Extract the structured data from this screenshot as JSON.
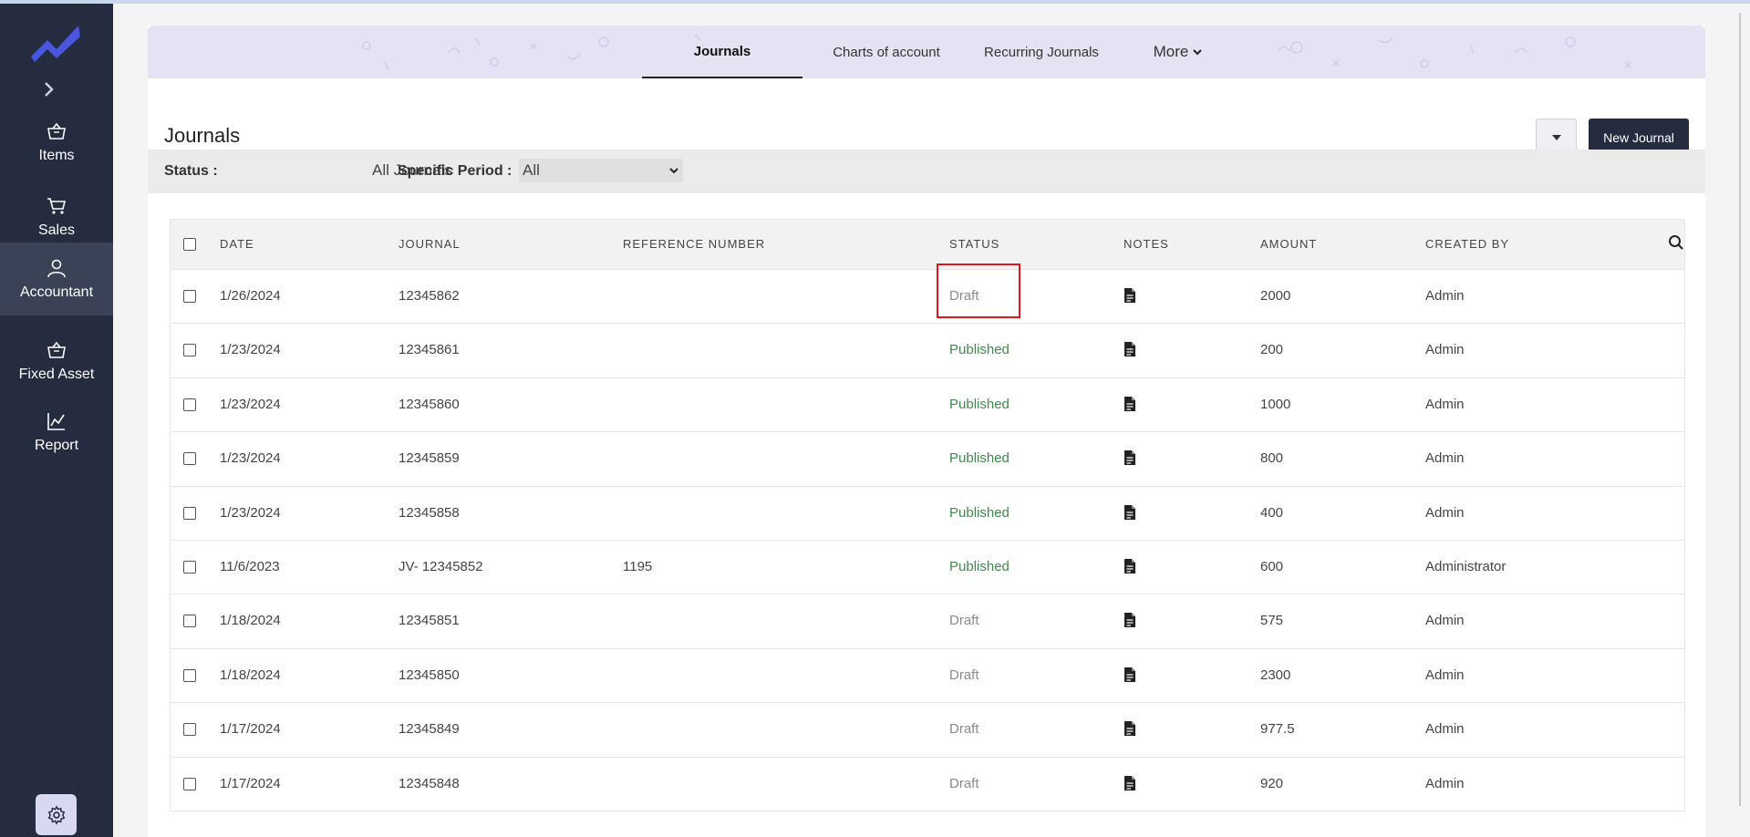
{
  "sidebar": {
    "items": [
      {
        "label": "Items",
        "icon": "basket-icon"
      },
      {
        "label": "Sales",
        "icon": "cart-icon"
      },
      {
        "label": "Accountant",
        "icon": "user-icon"
      },
      {
        "label": "Fixed Asset",
        "icon": "basket-icon"
      },
      {
        "label": "Report",
        "icon": "chart-line-icon"
      }
    ],
    "active": "Accountant"
  },
  "tabs": [
    {
      "label": "Journals",
      "active": true
    },
    {
      "label": "Charts of account",
      "active": false
    },
    {
      "label": "Recurring Journals",
      "active": false
    },
    {
      "label": "More",
      "active": false
    }
  ],
  "header": {
    "title": "Journals",
    "new_button": "New Journal"
  },
  "filters": {
    "status_label": "Status :",
    "status_value": "All Journals",
    "period_label": "Specific Period :",
    "period_value": "All"
  },
  "table": {
    "columns": [
      "DATE",
      "JOURNAL",
      "REFERENCE NUMBER",
      "STATUS",
      "NOTES",
      "AMOUNT",
      "CREATED BY"
    ],
    "rows": [
      {
        "date": "1/26/2024",
        "journal": "12345862",
        "reference": "",
        "status": "Draft",
        "amount": "2000",
        "created_by": "Admin"
      },
      {
        "date": "1/23/2024",
        "journal": "12345861",
        "reference": "",
        "status": "Published",
        "amount": "200",
        "created_by": "Admin"
      },
      {
        "date": "1/23/2024",
        "journal": "12345860",
        "reference": "",
        "status": "Published",
        "amount": "1000",
        "created_by": "Admin"
      },
      {
        "date": "1/23/2024",
        "journal": "12345859",
        "reference": "",
        "status": "Published",
        "amount": "800",
        "created_by": "Admin"
      },
      {
        "date": "1/23/2024",
        "journal": "12345858",
        "reference": "",
        "status": "Published",
        "amount": "400",
        "created_by": "Admin"
      },
      {
        "date": "11/6/2023",
        "journal": "JV- 12345852",
        "reference": "1195",
        "status": "Published",
        "amount": "600",
        "created_by": "Administrator"
      },
      {
        "date": "1/18/2024",
        "journal": "12345851",
        "reference": "",
        "status": "Draft",
        "amount": "575",
        "created_by": "Admin"
      },
      {
        "date": "1/18/2024",
        "journal": "12345850",
        "reference": "",
        "status": "Draft",
        "amount": "2300",
        "created_by": "Admin"
      },
      {
        "date": "1/17/2024",
        "journal": "12345849",
        "reference": "",
        "status": "Draft",
        "amount": "977.5",
        "created_by": "Admin"
      },
      {
        "date": "1/17/2024",
        "journal": "12345848",
        "reference": "",
        "status": "Draft",
        "amount": "920",
        "created_by": "Admin"
      }
    ]
  },
  "colors": {
    "sidebar_bg": "#252c40",
    "accent_logo": "#4a55e0",
    "tab_bg": "#e4e3f4",
    "published": "#3d8a4a",
    "draft": "#8a8a8a",
    "highlight": "#e0141d"
  }
}
